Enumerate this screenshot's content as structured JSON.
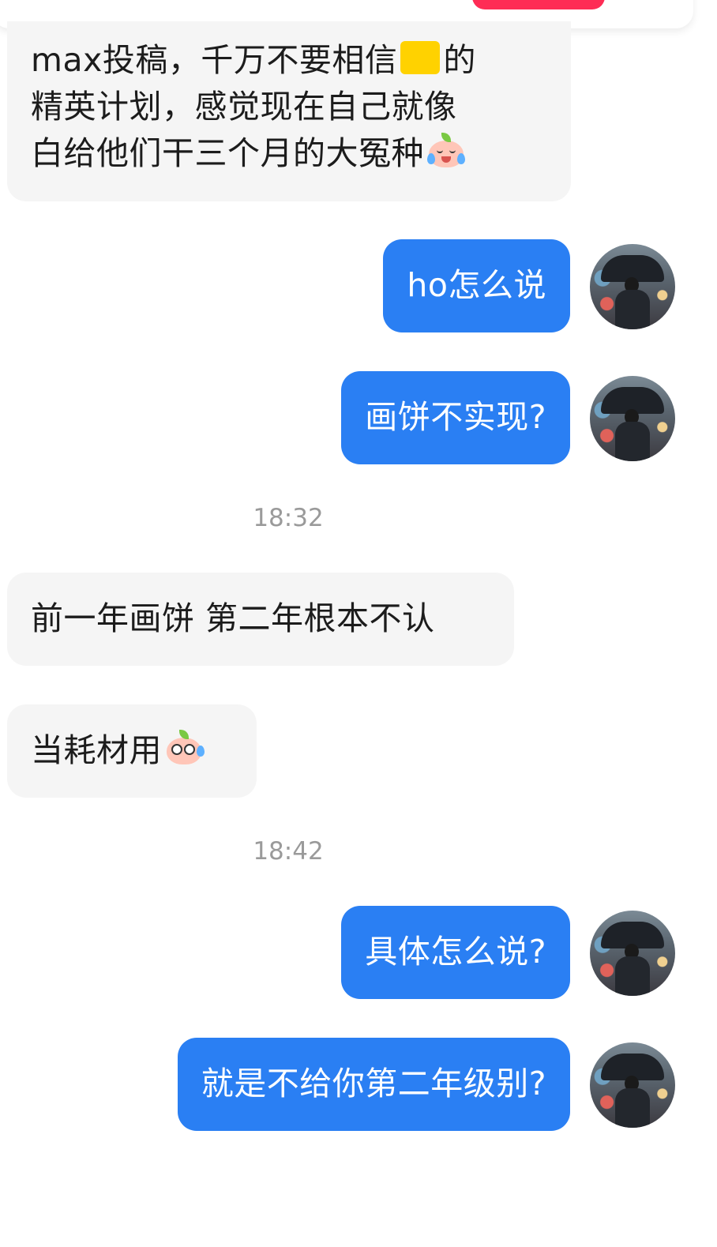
{
  "messages": [
    {
      "side": "in",
      "lines": [
        "max投稿，千万不要相信",
        "的",
        "精英计划，感觉现在自己就像",
        "白给他们干三个月的大冤种"
      ],
      "emojis": [
        "yellow-square-emoji",
        "crying-face-emoji"
      ]
    },
    {
      "side": "out",
      "text": "ho怎么说"
    },
    {
      "side": "out",
      "text": "画饼不实现?"
    },
    {
      "timestamp": "18:32"
    },
    {
      "side": "in",
      "text": "前一年画饼 第二年根本不认"
    },
    {
      "side": "in",
      "text": "当耗材用",
      "emoji": "sweating-face-emoji"
    },
    {
      "timestamp": "18:42"
    },
    {
      "side": "out",
      "text": "具体怎么说?"
    },
    {
      "side": "out",
      "text": "就是不给你第二年级别?"
    }
  ],
  "colors": {
    "outgoing_bubble": "#2a7ff3",
    "incoming_bubble": "#f5f5f5",
    "timestamp": "#9a9a9a",
    "top_button": "#fe2c55"
  }
}
